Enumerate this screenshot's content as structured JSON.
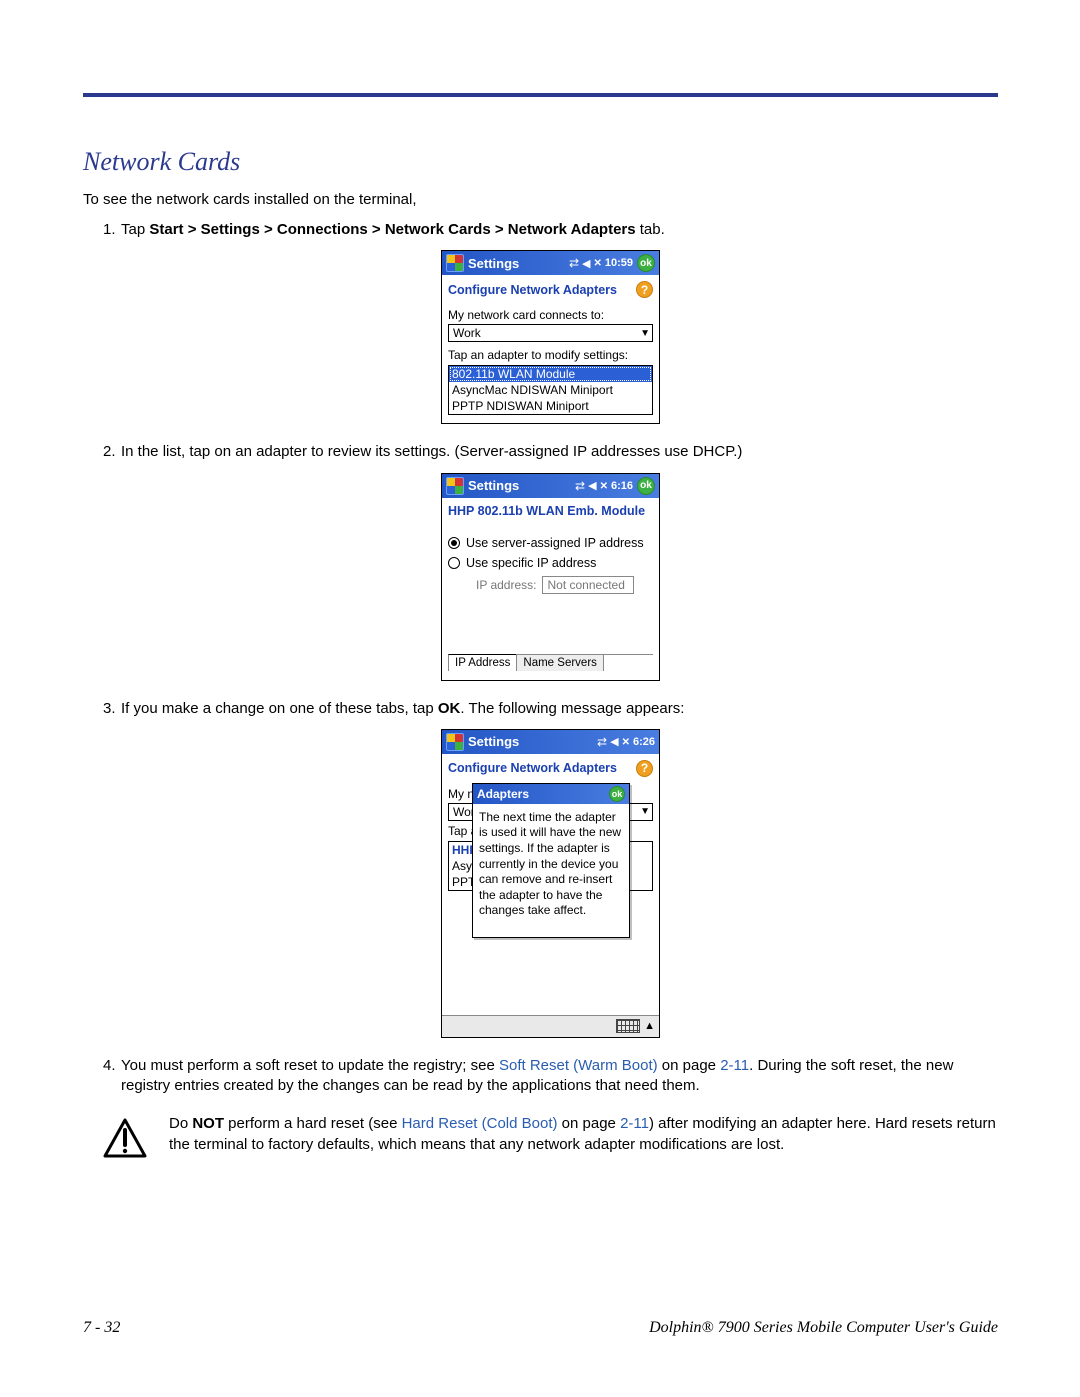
{
  "section_title": "Network Cards",
  "intro": "To see the network cards installed on the terminal,",
  "steps": {
    "s1": {
      "num": "1.",
      "pre": "Tap ",
      "path": "Start > Settings > Connections > Network Cards > Network Adapters",
      "post": " tab."
    },
    "s2": {
      "num": "2.",
      "text": "In the list, tap on an adapter to review its settings. (Server-assigned IP addresses use DHCP.)"
    },
    "s3": {
      "num": "3.",
      "pre": "If you make a change on one of these tabs, tap ",
      "ok": "OK",
      "post": ". The following message appears:"
    },
    "s4": {
      "num": "4.",
      "pre": "You must perform a soft reset to update the registry; see ",
      "link": "Soft Reset (Warm Boot)",
      "mid": " on page ",
      "pageref": "2-11",
      "post": ". During the soft reset, the new registry entries created by the changes can be read by the applications that need them."
    }
  },
  "warn": {
    "pre": "Do ",
    "not": "NOT",
    "mid1": " perform a hard reset (see ",
    "link": "Hard Reset (Cold Boot)",
    "mid2": " on page ",
    "pageref": "2-11",
    "post": ") after modifying an adapter here. Hard resets return the terminal to factory defaults, which means that any network adapter modifications are lost."
  },
  "shot1": {
    "title": "Settings",
    "time": "10:59",
    "ok": "ok",
    "subtitle": "Configure Network Adapters",
    "label_connects": "My network card connects to:",
    "select_value": "Work",
    "label_tap": "Tap an adapter to modify settings:",
    "opt_selected": "802.11b WLAN Module",
    "opt2": "AsyncMac NDISWAN Miniport",
    "opt3": "PPTP NDISWAN Miniport"
  },
  "shot2": {
    "title": "Settings",
    "time": "6:16",
    "ok": "ok",
    "subtitle": "HHP 802.11b WLAN Emb. Module",
    "radio1": "Use server-assigned IP address",
    "radio2": "Use specific IP address",
    "ip_label": "IP address:",
    "ip_value": "Not connected",
    "tab1": "IP Address",
    "tab2": "Name Servers"
  },
  "shot3": {
    "title": "Settings",
    "time": "6:26",
    "subtitle": "Configure Network Adapters",
    "under_label1": "My ne",
    "under_sel": "Wor",
    "under_label2": "Tap a",
    "under_o1": "HHP",
    "under_o2": "Asyn",
    "under_o3": "PPT",
    "dlg_title": "Adapters",
    "dlg_ok": "ok",
    "dlg_body": "The next time the adapter is used it will have the new settings.\nIf the adapter is currently in the device you can remove and re-insert the adapter to have the changes take affect."
  },
  "footer": {
    "page": "7 - 32",
    "guide": "Dolphin® 7900 Series Mobile Computer User's Guide"
  }
}
